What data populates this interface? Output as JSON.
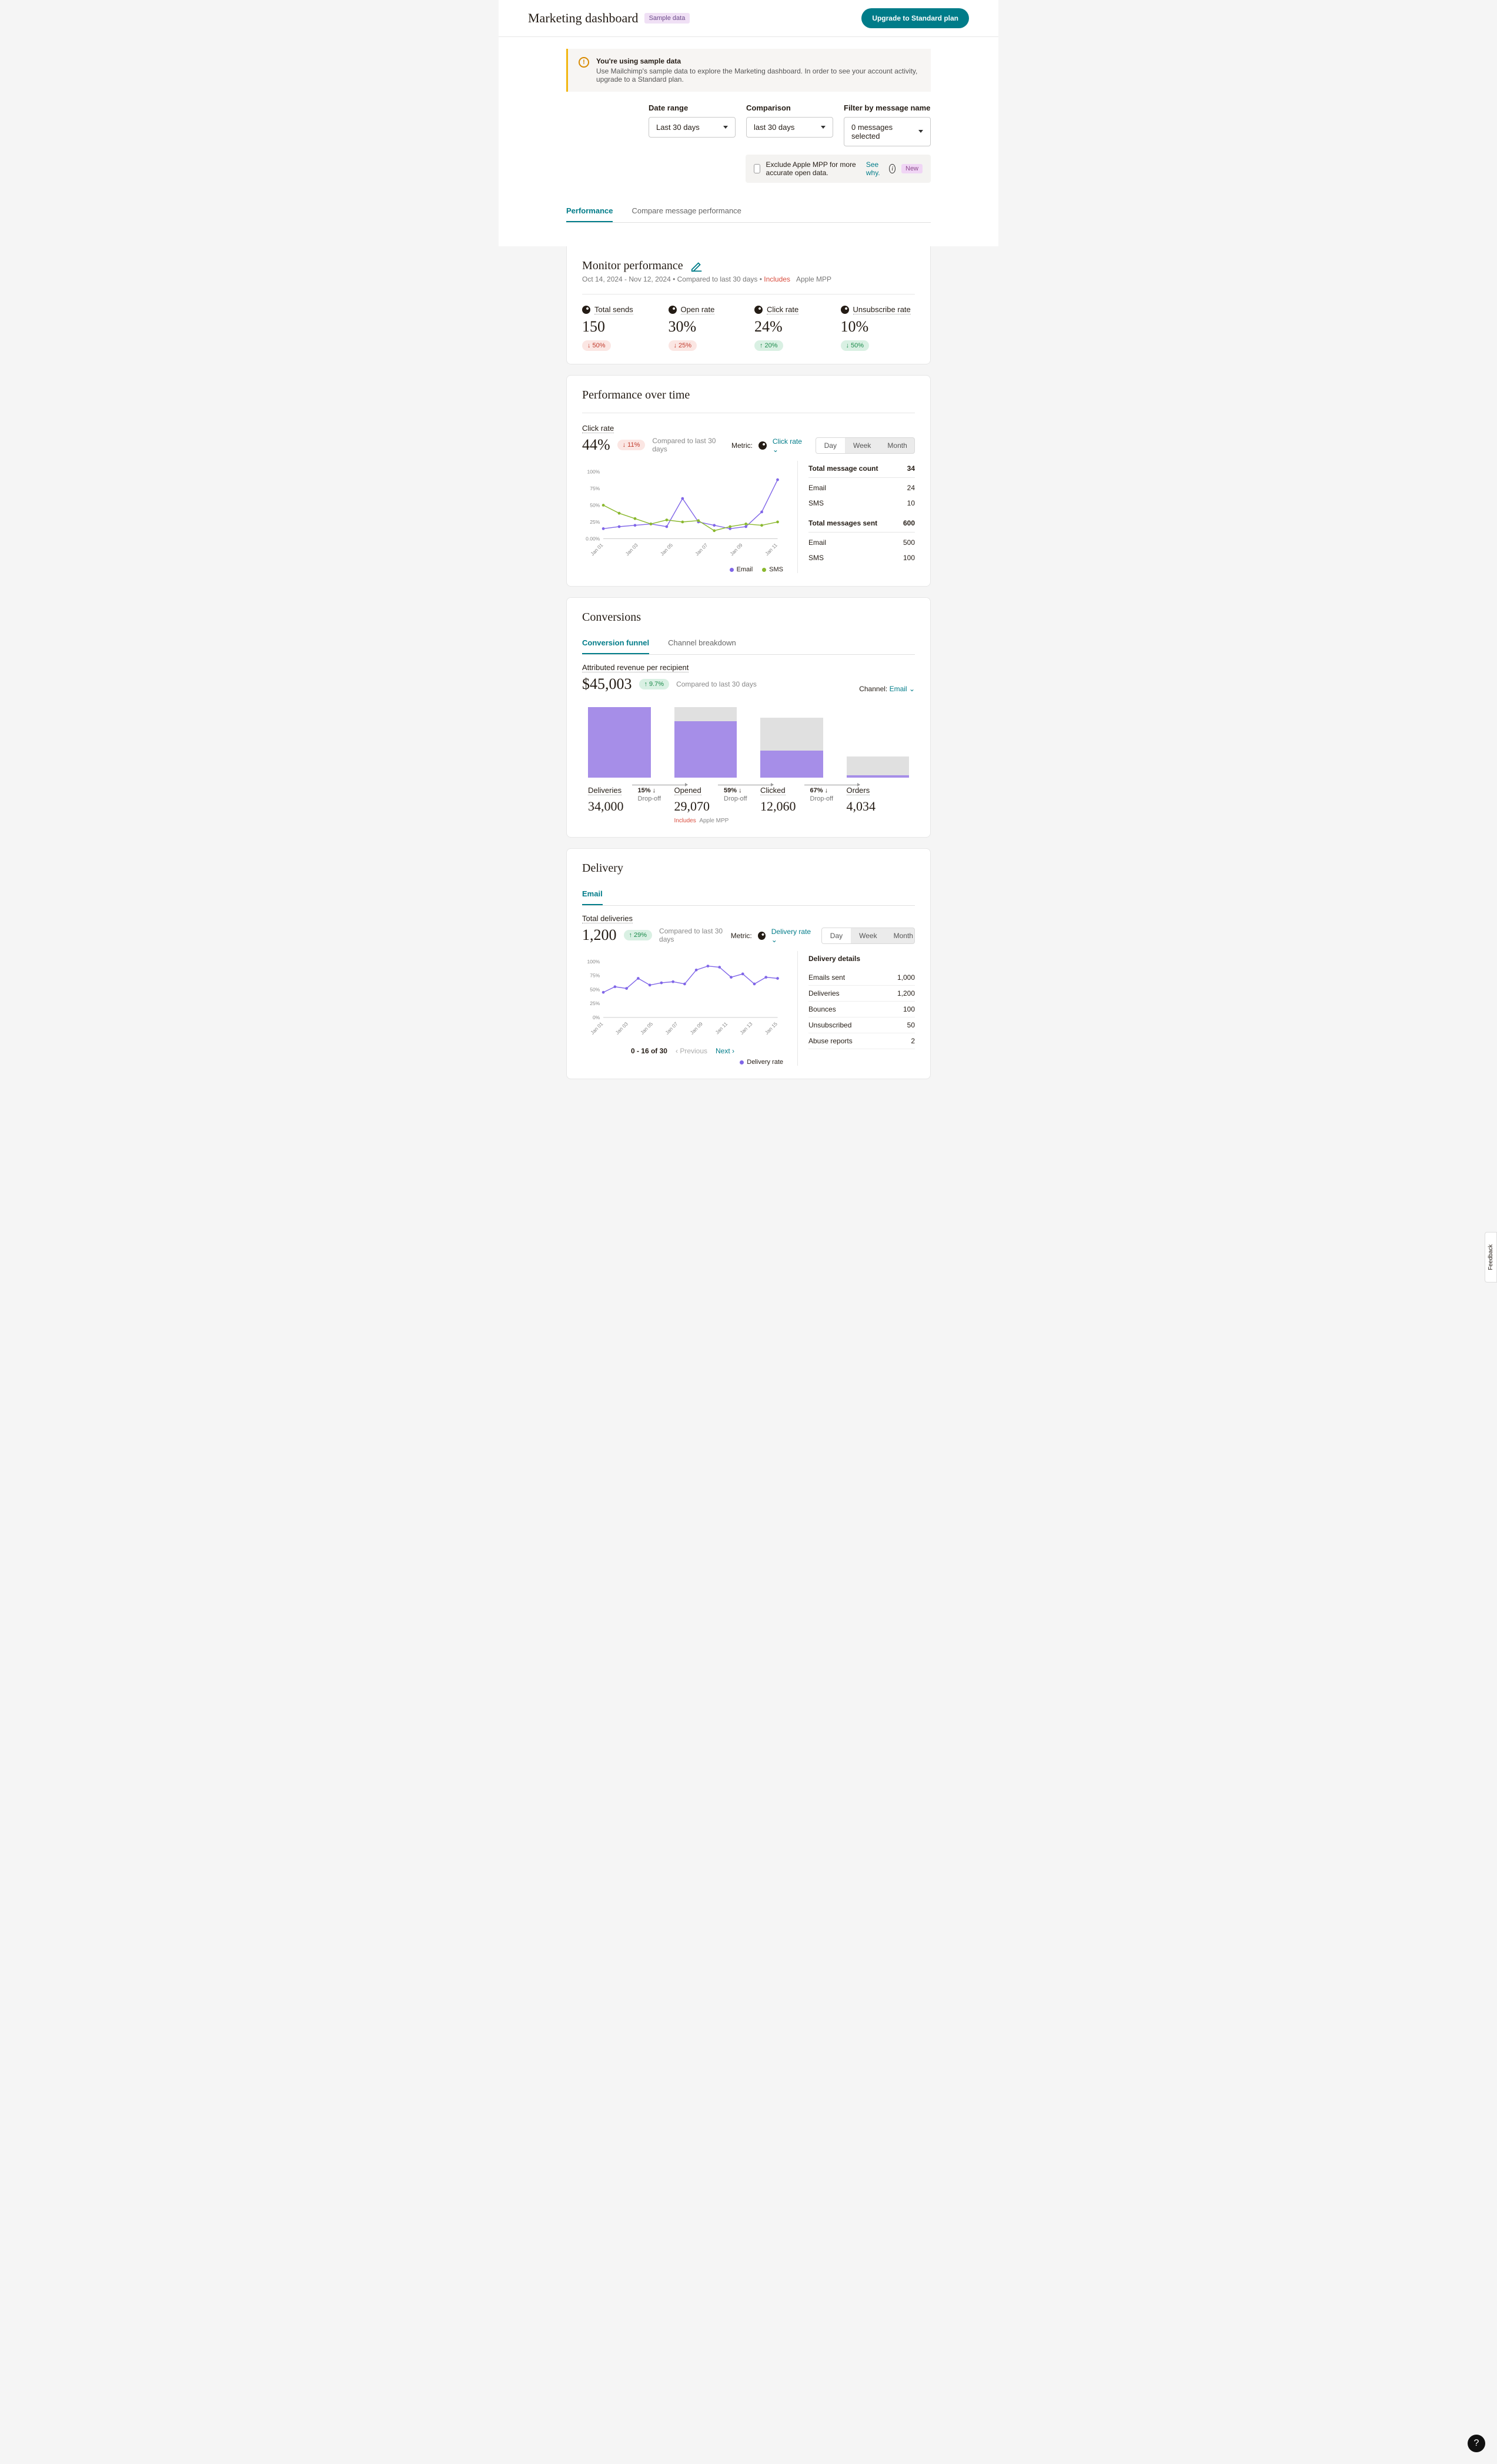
{
  "header": {
    "title": "Marketing dashboard",
    "sample_badge": "Sample data",
    "upgrade_btn": "Upgrade to Standard plan"
  },
  "alert": {
    "title": "You're using sample data",
    "text": "Use Mailchimp's sample data to explore the Marketing dashboard. In order to see your account activity, upgrade to a Standard plan."
  },
  "filters": {
    "date_range": {
      "label": "Date range",
      "value": "Last 30 days"
    },
    "comparison": {
      "label": "Comparison",
      "value": "last 30 days"
    },
    "message_filter": {
      "label": "Filter by message name",
      "value": "0 messages selected"
    }
  },
  "mpp": {
    "text": "Exclude Apple MPP for more accurate open data.",
    "link": "See why.",
    "badge": "New"
  },
  "main_tabs": {
    "performance": "Performance",
    "compare": "Compare message performance"
  },
  "monitor": {
    "title": "Monitor performance",
    "subtitle_range": "Oct 14, 2024 - Nov 12, 2024 • Compared to last 30 days •",
    "includes": "Includes",
    "apple_mpp": "Apple MPP",
    "kpis": [
      {
        "label": "Total sends",
        "value": "150",
        "delta": "50%",
        "dir": "down"
      },
      {
        "label": "Open rate",
        "value": "30%",
        "delta": "25%",
        "dir": "down"
      },
      {
        "label": "Click rate",
        "value": "24%",
        "delta": "20%",
        "dir": "up"
      },
      {
        "label": "Unsubscribe rate",
        "value": "10%",
        "delta": "50%",
        "dir": "down-green"
      }
    ]
  },
  "perf_over_time": {
    "title": "Performance over time",
    "metric_label": "Click rate",
    "value": "44%",
    "delta": "11%",
    "compare": "Compared to last 30 days",
    "metric_prefix": "Metric:",
    "metric_sel": "Click rate",
    "seg": {
      "day": "Day",
      "week": "Week",
      "month": "Month"
    },
    "side": {
      "msg_count_label": "Total message count",
      "msg_count": "34",
      "email_label": "Email",
      "email_count": "24",
      "sms_label": "SMS",
      "sms_count": "10",
      "sent_label": "Total messages sent",
      "sent": "600",
      "email_sent": "500",
      "sms_sent": "100"
    },
    "legend": {
      "email": "Email",
      "sms": "SMS"
    }
  },
  "chart_data": {
    "perf": {
      "type": "line",
      "y_ticks": [
        "0.00%",
        "25%",
        "50%",
        "75%",
        "100%"
      ],
      "x_categories": [
        "Jan 01",
        "Jan 03",
        "Jan 05",
        "Jan 07",
        "Jan 09",
        "Jan 11"
      ],
      "series": [
        {
          "name": "Email",
          "color": "#8066e8",
          "values": [
            15,
            18,
            20,
            22,
            18,
            60,
            25,
            20,
            15,
            18,
            40,
            88
          ]
        },
        {
          "name": "SMS",
          "color": "#8ab82e",
          "values": [
            50,
            38,
            30,
            22,
            28,
            25,
            27,
            12,
            18,
            22,
            20,
            25
          ]
        }
      ]
    },
    "delivery": {
      "type": "line",
      "y_ticks": [
        "0%",
        "25%",
        "50%",
        "75%",
        "100%"
      ],
      "x_categories": [
        "Jan 01",
        "Jan 03",
        "Jan 05",
        "Jan 07",
        "Jan 09",
        "Jan 11",
        "Jan 13",
        "Jan 15"
      ],
      "series": [
        {
          "name": "Delivery rate",
          "color": "#8066e8",
          "values": [
            45,
            55,
            52,
            70,
            58,
            62,
            64,
            60,
            85,
            92,
            90,
            72,
            78,
            60,
            72,
            70
          ]
        }
      ]
    }
  },
  "conversions": {
    "title": "Conversions",
    "tabs": {
      "funnel": "Conversion funnel",
      "channel": "Channel breakdown"
    },
    "rev_label": "Attributed revenue per recipient",
    "rev_value": "$45,003",
    "rev_delta": "9.7%",
    "compare": "Compared to last 30 days",
    "channel_prefix": "Channel:",
    "channel_sel": "Email",
    "funnel": [
      {
        "name": "Deliveries",
        "value": "34,000",
        "bar": 100,
        "fill": 100,
        "drop": "15%",
        "drop_label": "Drop-off"
      },
      {
        "name": "Opened",
        "value": "29,070",
        "bar": 100,
        "fill": 80,
        "drop": "59%",
        "drop_label": "Drop-off",
        "includes": "Includes",
        "mpp": "Apple MPP"
      },
      {
        "name": "Clicked",
        "value": "12,060",
        "bar": 85,
        "fill": 45,
        "drop": "67%",
        "drop_label": "Drop-off"
      },
      {
        "name": "Orders",
        "value": "4,034",
        "bar": 30,
        "fill": 10
      }
    ]
  },
  "delivery": {
    "title": "Delivery",
    "tab": "Email",
    "total_label": "Total deliveries",
    "total_value": "1,200",
    "delta": "29%",
    "compare": "Compared to last 30 days",
    "metric_prefix": "Metric:",
    "metric_sel": "Delivery rate",
    "seg": {
      "day": "Day",
      "week": "Week",
      "month": "Month"
    },
    "pager": {
      "range": "0 - 16 of 30",
      "prev": "Previous",
      "next": "Next"
    },
    "legend": "Delivery rate",
    "side": {
      "title": "Delivery details",
      "rows": [
        {
          "label": "Emails sent",
          "value": "1,000"
        },
        {
          "label": "Deliveries",
          "value": "1,200"
        },
        {
          "label": "Bounces",
          "value": "100"
        },
        {
          "label": "Unsubscribed",
          "value": "50"
        },
        {
          "label": "Abuse reports",
          "value": "2"
        }
      ]
    }
  },
  "feedback": "Feedback"
}
